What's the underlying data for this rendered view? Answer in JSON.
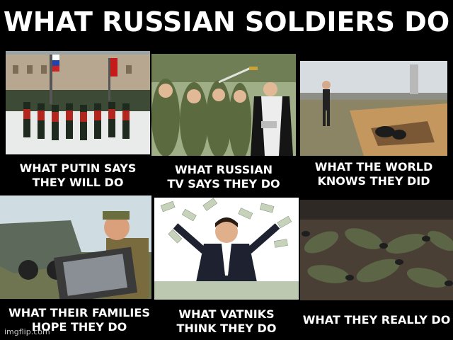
{
  "meme": {
    "title": "WHAT RUSSIAN SOLDIERS DO",
    "panels": [
      {
        "caption_line1": "WHAT PUTIN SAYS",
        "caption_line2": "THEY WILL DO"
      },
      {
        "caption_line1": "WHAT RUSSIAN",
        "caption_line2": "TV SAYS THEY DO"
      },
      {
        "caption_line1": "WHAT THE WORLD",
        "caption_line2": "KNOWS THEY DID"
      },
      {
        "caption_line1": "WHAT THEIR FAMILIES",
        "caption_line2": "HOPE THEY DO"
      },
      {
        "caption_line1": "WHAT VATNIKS",
        "caption_line2": "THINK THEY DO"
      },
      {
        "caption_line1": "WHAT THEY REALLY DO",
        "caption_line2": ""
      }
    ],
    "watermark": "imgflip.com"
  },
  "images": {
    "parade": "soldiers-marching-parade-photo",
    "blessing": "priest-blessing-soldiers-photo",
    "field": "man-walking-by-trench-photo",
    "tv": "soldier-carrying-television-photo",
    "money": "man-in-suit-throwing-money-photo",
    "bodies": "fallen-soldiers-on-ground-photo"
  },
  "colors": {
    "background": "#000000",
    "text": "#ffffff",
    "watermark": "#c8c8c8"
  }
}
